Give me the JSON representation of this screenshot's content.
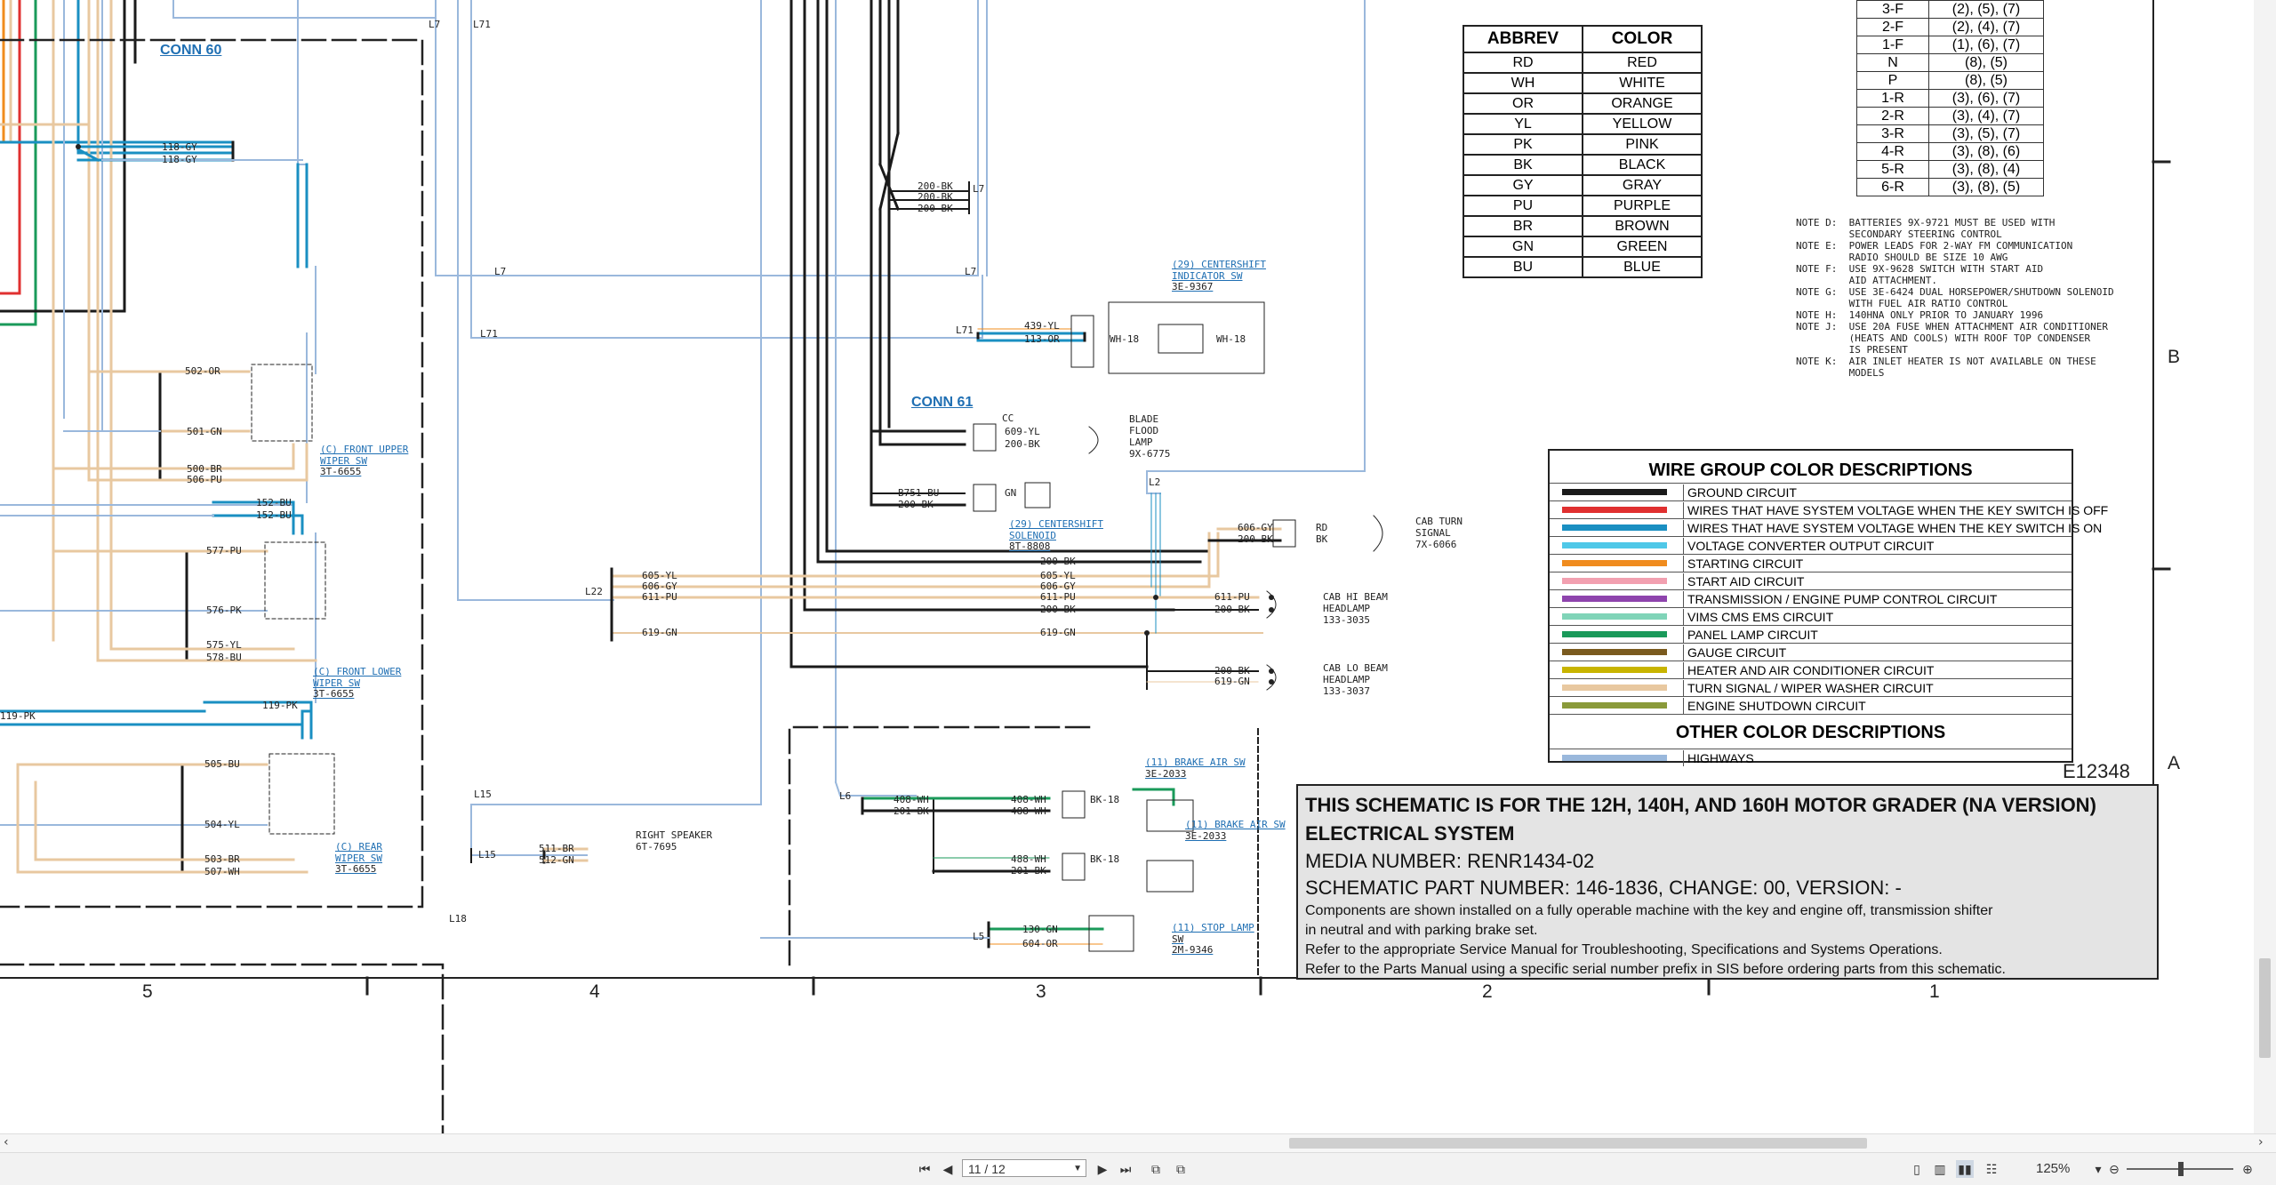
{
  "schematic": {
    "connectors": {
      "conn60": "CONN 60",
      "conn61": "CONN 61"
    },
    "zones": {
      "z5": "5",
      "z4": "4",
      "z3": "3",
      "z2": "2",
      "z1": "1",
      "rowB": "B",
      "rowA": "A"
    },
    "drawing_id": "E12348",
    "components": {
      "front_upper_wiper": [
        "(C) FRONT UPPER",
        "WIPER SW",
        "3T-6655"
      ],
      "front_lower_wiper": [
        "(C) FRONT LOWER",
        "WIPER SW",
        "3T-6655"
      ],
      "rear_wiper": [
        "(C) REAR",
        "WIPER SW",
        "3T-6655"
      ],
      "centershift_indicator": [
        "(29) CENTERSHIFT",
        "INDICATOR SW",
        "3E-9367"
      ],
      "centershift_solenoid": [
        "(29) CENTERSHIFT",
        "SOLENOID",
        "8T-8808"
      ],
      "blade_flood_lamp": [
        "BLADE",
        "FLOOD",
        "LAMP",
        "9X-6775"
      ],
      "cab_turn_signal": [
        "CAB TURN",
        "SIGNAL",
        "7X-6066"
      ],
      "cab_hi_beam": [
        "CAB HI BEAM",
        "HEADLAMP",
        "133-3035"
      ],
      "cab_lo_beam": [
        "CAB LO BEAM",
        "HEADLAMP",
        "133-3037"
      ],
      "right_speaker": [
        "RIGHT SPEAKER",
        "6T-7695"
      ],
      "brake_air_sw_1": [
        "(11) BRAKE AIR SW",
        "3E-2033"
      ],
      "brake_air_sw_2": [
        "(11) BRAKE AIR SW",
        "3E-2033"
      ],
      "stop_lamp_sw": [
        "(11) STOP LAMP",
        "SW",
        "2M-9346"
      ]
    },
    "wire_labels": {
      "w118a": "118-GY",
      "w118b": "118-GY",
      "w502": "502-OR",
      "w501": "501-GN",
      "w500": "500-BR",
      "w506": "506-PU",
      "w152a": "152-BU",
      "w152b": "152-BU",
      "w577": "577-PU",
      "w576": "576-PK",
      "w575": "575-YL",
      "w578": "578-BU",
      "w119a": "119-PK",
      "w119b": "119-PK",
      "w505": "505-BU",
      "w504": "504-YL",
      "w503": "503-BR",
      "w507": "507-WH",
      "w200a": "200-BK",
      "w200b": "200-BK",
      "w200c": "200-BK",
      "w439": "439-YL",
      "w113": "113-OR",
      "w609": "609-YL",
      "w200d": "200-BK",
      "wB751": "B751-BU",
      "w200e": "200-BK",
      "w605": "605-YL",
      "w606": "606-GY",
      "w611": "611-PU",
      "w619": "619-GN",
      "w200f": "200-BK",
      "w605b": "605-YL",
      "w606b": "606-GY",
      "w611b": "611-PU",
      "w200g": "200-BK",
      "w619b": "619-GN",
      "w606c": "606-GY",
      "w200h": "200-BK",
      "w611c": "611-PU",
      "w200i": "200-BK",
      "w200j": "200-BK",
      "w619c": "619-GN",
      "w511": "511-BR",
      "w512": "512-GN",
      "w408": "408-WH",
      "w201": "201-BK",
      "w408b": "408-WH",
      "w488": "488-WH",
      "w488b": "488-WH",
      "w201b": "201-BK",
      "w130": "130-GN",
      "w604": "604-OR",
      "L7": "L7",
      "L71": "L71",
      "L22": "L22",
      "L15": "L15",
      "L6": "L6",
      "L5": "L5",
      "L18": "L18",
      "L2": "L2",
      "RD": "RD",
      "BK": "BK",
      "CC": "CC",
      "WH18": "WH-18",
      "BK18": "BK-18",
      "GN": "GN"
    }
  },
  "color_table": {
    "headers": [
      "ABBREV",
      "COLOR"
    ],
    "rows": [
      [
        "RD",
        "RED"
      ],
      [
        "WH",
        "WHITE"
      ],
      [
        "OR",
        "ORANGE"
      ],
      [
        "YL",
        "YELLOW"
      ],
      [
        "PK",
        "PINK"
      ],
      [
        "BK",
        "BLACK"
      ],
      [
        "GY",
        "GRAY"
      ],
      [
        "PU",
        "PURPLE"
      ],
      [
        "BR",
        "BROWN"
      ],
      [
        "GN",
        "GREEN"
      ],
      [
        "BU",
        "BLUE"
      ]
    ]
  },
  "gear_table": {
    "rows": [
      [
        "3-F",
        "(2), (5), (7)"
      ],
      [
        "2-F",
        "(2), (4), (7)"
      ],
      [
        "1-F",
        "(1), (6), (7)"
      ],
      [
        "N",
        "(8), (5)"
      ],
      [
        "P",
        "(8), (5)"
      ],
      [
        "1-R",
        "(3), (6), (7)"
      ],
      [
        "2-R",
        "(3), (4), (7)"
      ],
      [
        "3-R",
        "(3), (5), (7)"
      ],
      [
        "4-R",
        "(3), (8), (6)"
      ],
      [
        "5-R",
        "(3), (8), (4)"
      ],
      [
        "6-R",
        "(3), (8), (5)"
      ]
    ]
  },
  "notes": [
    "NOTE D:  BATTERIES 9X-9721 MUST BE USED WITH",
    "         SECONDARY STEERING CONTROL",
    "NOTE E:  POWER LEADS FOR 2-WAY FM COMMUNICATION",
    "         RADIO SHOULD BE SIZE 10 AWG",
    "NOTE F:  USE 9X-9628 SWITCH WITH START AID",
    "         AID ATTACHMENT.",
    "NOTE G:  USE 3E-6424 DUAL HORSEPOWER/SHUTDOWN SOLENOID",
    "         WITH FUEL AIR RATIO CONTROL",
    "NOTE H:  140HNA ONLY PRIOR TO JANUARY 1996",
    "NOTE J:  USE 20A FUSE WHEN ATTACHMENT AIR CONDITIONER",
    "         (HEATS AND COOLS) WITH ROOF TOP CONDENSER",
    "         IS PRESENT",
    "NOTE K:  AIR INLET HEATER IS NOT AVAILABLE ON THESE",
    "         MODELS"
  ],
  "wire_group": {
    "title": "WIRE GROUP COLOR DESCRIPTIONS",
    "items": [
      {
        "color": "#1a1a1a",
        "label": "GROUND CIRCUIT"
      },
      {
        "color": "#e03030",
        "label": "WIRES THAT HAVE SYSTEM VOLTAGE WHEN THE KEY SWITCH IS OFF"
      },
      {
        "color": "#1a8fc2",
        "label": "WIRES THAT HAVE SYSTEM VOLTAGE WHEN THE KEY SWITCH IS ON"
      },
      {
        "color": "#4fc8e8",
        "label": "VOLTAGE CONVERTER OUTPUT CIRCUIT"
      },
      {
        "color": "#f08c1e",
        "label": "STARTING CIRCUIT"
      },
      {
        "color": "#f2a0b0",
        "label": "START AID CIRCUIT"
      },
      {
        "color": "#8e44ad",
        "label": "TRANSMISSION / ENGINE PUMP CONTROL CIRCUIT"
      },
      {
        "color": "#80d4b8",
        "label": "VIMS CMS EMS CIRCUIT"
      },
      {
        "color": "#1a9a5a",
        "label": "PANEL LAMP CIRCUIT"
      },
      {
        "color": "#7a5a1e",
        "label": "GAUGE CIRCUIT"
      },
      {
        "color": "#c8b400",
        "label": "HEATER AND AIR CONDITIONER CIRCUIT"
      },
      {
        "color": "#e8c8a0",
        "label": "TURN SIGNAL / WIPER WASHER CIRCUIT"
      },
      {
        "color": "#8a9a3a",
        "label": "ENGINE SHUTDOWN CIRCUIT"
      }
    ],
    "other_title": "OTHER COLOR DESCRIPTIONS",
    "other_items": [
      {
        "color": "#9ab8dc",
        "label": "HIGHWAYS"
      }
    ]
  },
  "title_block": {
    "line1": "THIS SCHEMATIC IS FOR THE 12H, 140H, AND 160H MOTOR GRADER (NA VERSION)",
    "line2": "ELECTRICAL SYSTEM",
    "media": "MEDIA NUMBER: RENR1434-02",
    "part": "SCHEMATIC PART NUMBER: 146-1836, CHANGE: 00, VERSION: -",
    "desc1": "Components are shown installed on a fully operable machine with the key and engine off, transmission shifter",
    "desc2": "in neutral and with parking brake set.",
    "desc3": "Refer to the appropriate Service Manual for Troubleshooting, Specifications and Systems Operations.",
    "desc4": "Refer to the Parts Manual using a specific serial number prefix in SIS before ordering parts from this schematic."
  },
  "statusbar": {
    "page": "11 / 12",
    "zoom": "125%"
  }
}
